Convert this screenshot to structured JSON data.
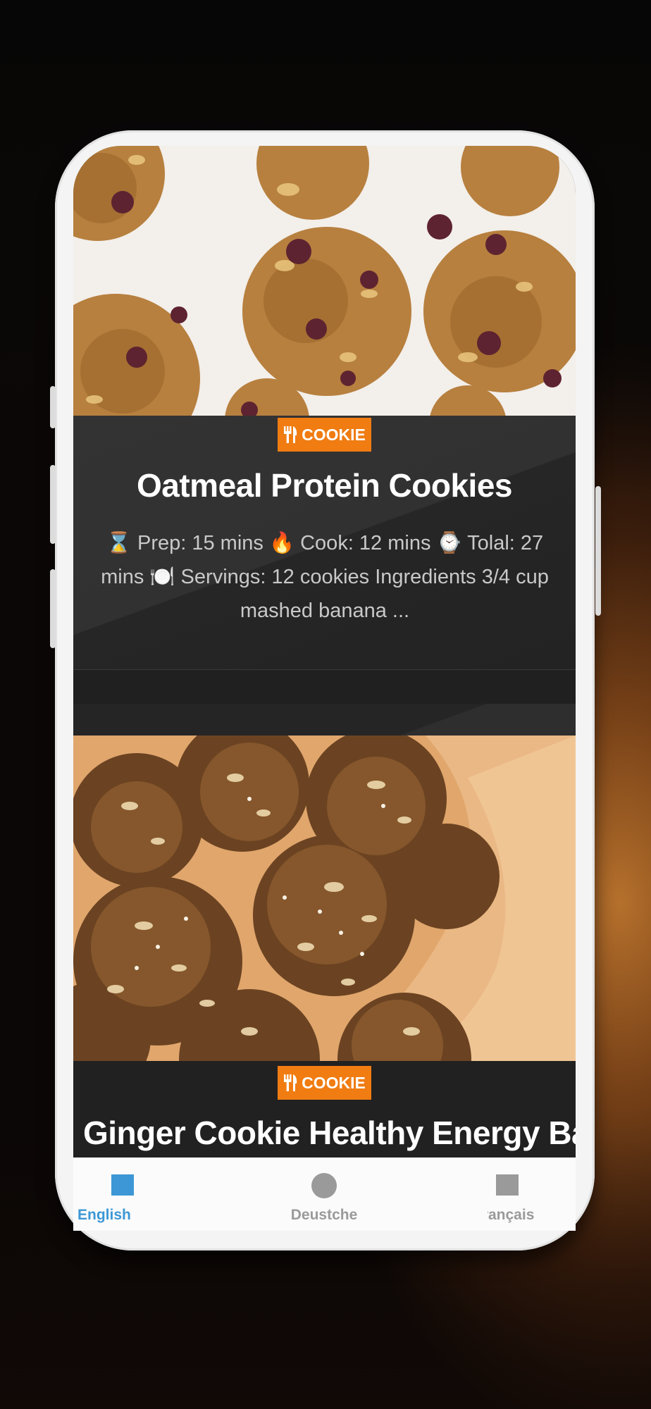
{
  "recipes": [
    {
      "category": "COOKIE",
      "title": "Oatmeal Protein Cookies",
      "excerpt": "⌛ Prep: 15 mins 🔥 Cook: 12 mins ⌚ Tolal: 27 mins 🍽️ Servings: 12 cookies Ingredients 3/4 cup mashed banana ..."
    },
    {
      "category": "COOKIE",
      "title": "Ginger Cookie Healthy Energy Balls"
    }
  ],
  "bottom_nav": {
    "items": [
      {
        "label": "English",
        "active": true
      },
      {
        "label": "Deustche",
        "active": false
      },
      {
        "label": "Français",
        "active": false
      }
    ]
  },
  "colors": {
    "accent": "#f07c12",
    "nav_active": "#3d97d6",
    "nav_inactive": "#9a9a9a",
    "card_bg": "#2e2e2e"
  }
}
